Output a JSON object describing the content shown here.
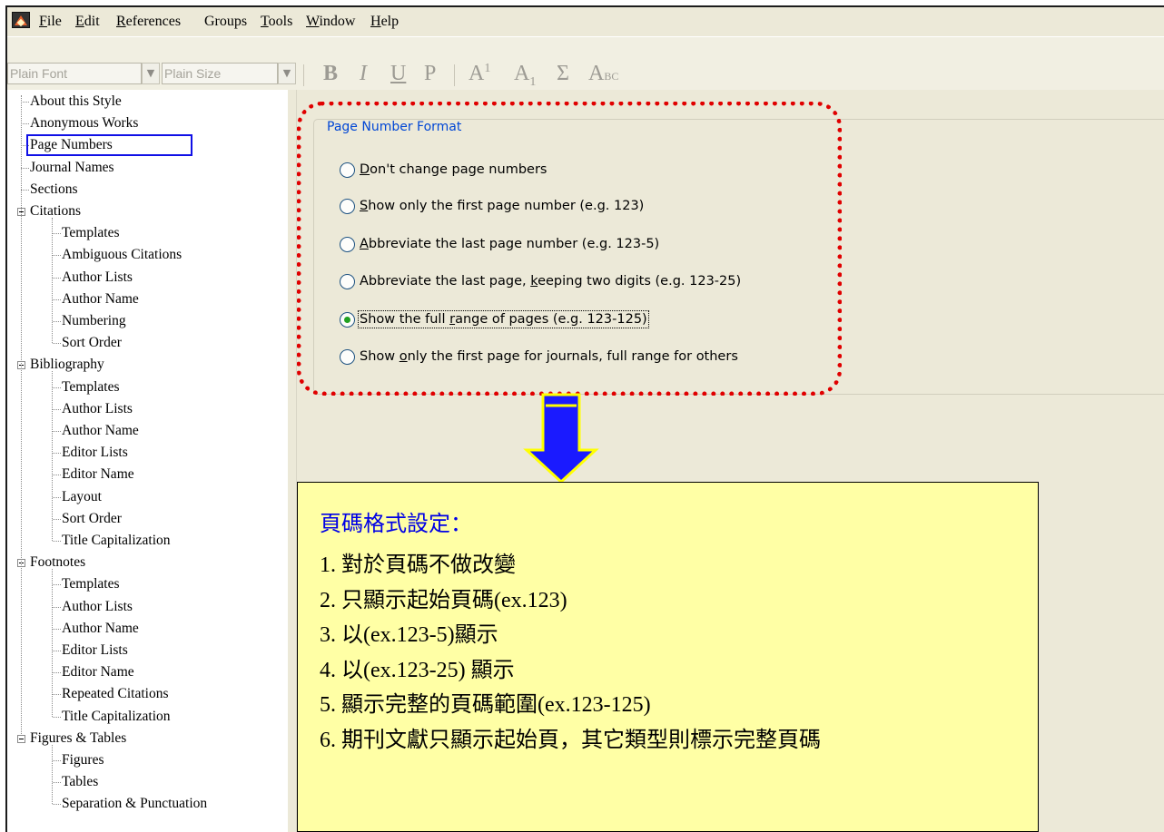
{
  "menu": {
    "items": [
      {
        "label": "File",
        "underline": "F"
      },
      {
        "label": "Edit",
        "underline": "E"
      },
      {
        "label": "References",
        "underline": "R"
      },
      {
        "label": "Groups",
        "underline": ""
      },
      {
        "label": "Tools",
        "underline": "T"
      },
      {
        "label": "Window",
        "underline": "W"
      },
      {
        "label": "Help",
        "underline": "H"
      }
    ]
  },
  "toolbar": {
    "font_value": "Plain Font",
    "size_value": "Plain Size",
    "bold": "B",
    "italic": "I",
    "underline": "U",
    "plain": "P",
    "superscript": "A",
    "superscript_mark": "1",
    "subscript": "A",
    "subscript_mark": "1",
    "symbol": "Σ",
    "smallcaps_big": "A",
    "smallcaps_small": "BC"
  },
  "tree": {
    "top_items": [
      "About this Style",
      "Anonymous Works",
      "Page Numbers",
      "Journal Names",
      "Sections"
    ],
    "selected": "Page Numbers",
    "groups": [
      {
        "label": "Citations",
        "children": [
          "Templates",
          "Ambiguous Citations",
          "Author Lists",
          "Author Name",
          "Numbering",
          "Sort Order"
        ]
      },
      {
        "label": "Bibliography",
        "children": [
          "Templates",
          "Author Lists",
          "Author Name",
          "Editor Lists",
          "Editor Name",
          "Layout",
          "Sort Order",
          "Title Capitalization"
        ]
      },
      {
        "label": "Footnotes",
        "children": [
          "Templates",
          "Author Lists",
          "Author Name",
          "Editor Lists",
          "Editor Name",
          "Repeated Citations",
          "Title Capitalization"
        ]
      },
      {
        "label": "Figures & Tables",
        "children": [
          "Figures",
          "Tables",
          "Separation & Punctuation"
        ]
      }
    ]
  },
  "page_number_format": {
    "title": "Page Number Format",
    "options": [
      {
        "pre": "",
        "key": "D",
        "post": "on't change page numbers",
        "checked": false
      },
      {
        "pre": "",
        "key": "S",
        "post": "how only the first page number (e.g. 123)",
        "checked": false
      },
      {
        "pre": "",
        "key": "A",
        "post": "bbreviate the last page number (e.g. 123-5)",
        "checked": false
      },
      {
        "pre": "Abbreviate the last page, ",
        "key": "k",
        "post": "eeping two digits (e.g. 123-25)",
        "checked": false
      },
      {
        "pre": "Show the full ",
        "key": "r",
        "post": "ange of pages (e.g. 123-125)",
        "checked": true
      },
      {
        "pre": "Show ",
        "key": "o",
        "post": "nly the first page for journals, full range for others",
        "checked": false
      }
    ]
  },
  "annotation": {
    "title": "頁碼格式設定：",
    "items": [
      "1.  對於頁碼不做改變",
      "2.  只顯示起始頁碼(ex.123)",
      "3.  以(ex.123-5)顯示",
      "4.  以(ex.123-25) 顯示",
      "5.  顯示完整的頁碼範圍(ex.123-125)",
      "6.  期刊文獻只顯示起始頁，其它類型則標示完整頁碼"
    ]
  },
  "colors": {
    "highlight_outline": "#e00000",
    "selection_box": "#1010e6",
    "arrow_fill": "#1a1aff",
    "arrow_border": "#ffff00",
    "note_background": "#ffffa5",
    "note_title": "#0000e6"
  }
}
